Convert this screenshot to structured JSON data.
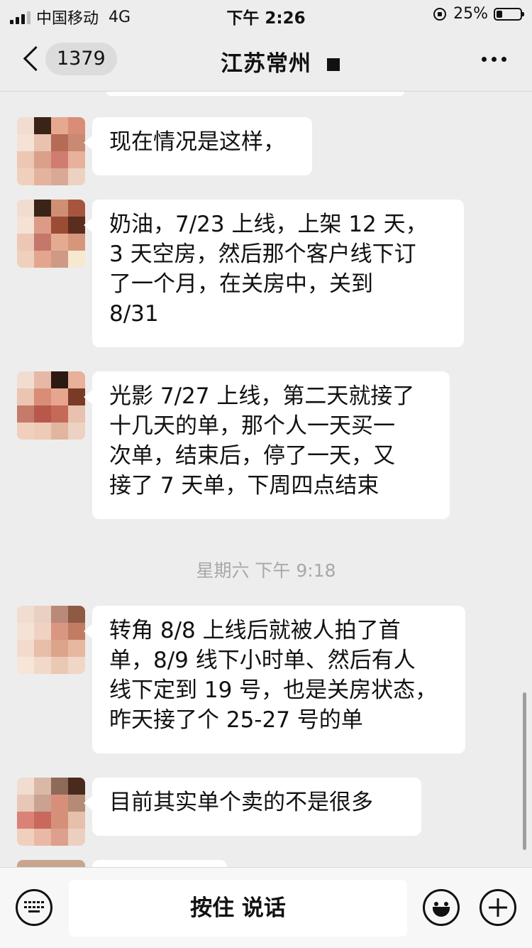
{
  "status_bar": {
    "carrier": "中国移动",
    "network": "4G",
    "time": "下午 2:26",
    "battery_percent_text": "25%",
    "battery_level": 0.25
  },
  "nav": {
    "unread_count": "1379",
    "title": "江苏常州"
  },
  "messages": [
    {
      "text": "现在情况是这样，"
    },
    {
      "text": "奶油，7/23 上线，上架 12 天，\n3 天空房，然后那个客户线下订\n了一个月，在关房中，关到\n8/31"
    },
    {
      "text": "光影 7/27 上线，第二天就接了\n十几天的单，那个人一天买一\n次单，结束后，停了一天，又\n接了 7 天单，下周四点结束"
    },
    {
      "text": "转角 8/8 上线后就被人拍了首\n单，8/9 线下小时单、然后有人\n线下定到 19 号，也是关房状态，\n昨天接了个 25-27 号的单"
    },
    {
      "text": "目前其实单个卖的不是很多"
    }
  ],
  "time_divider": "星期六 下午 9:18",
  "input_bar": {
    "hold_to_talk": "按住 说话",
    "keyboard_icon": "keyboard-icon",
    "emoji_icon": "emoji-icon",
    "plus_icon": "plus-icon"
  },
  "colors": {
    "background": "#ededed",
    "bubble": "#ffffff",
    "divider_text": "#a8a8a8"
  }
}
